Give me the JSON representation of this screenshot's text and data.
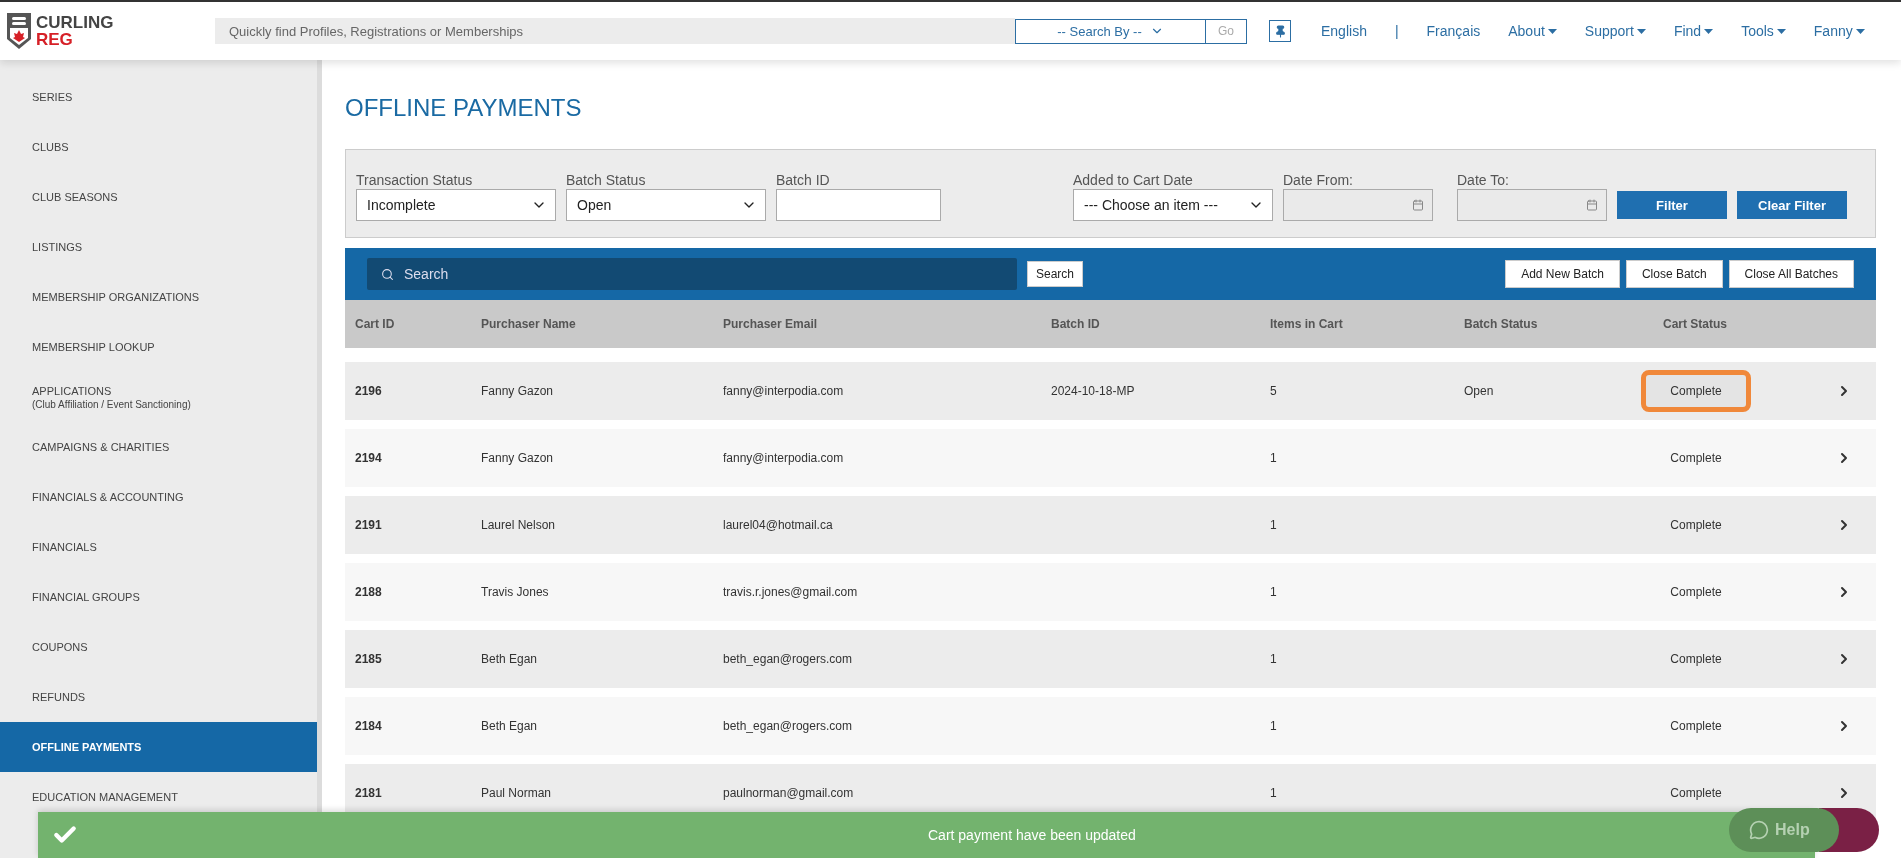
{
  "header": {
    "logo_line1": "CURLING",
    "logo_line2": "REG",
    "search_placeholder": "Quickly find Profiles, Registrations or Memberships",
    "search_by": "-- Search By --",
    "go": "Go",
    "nav": [
      {
        "label": "English",
        "kind": "link"
      },
      {
        "label": "|",
        "kind": "separator"
      },
      {
        "label": "Français",
        "kind": "link"
      },
      {
        "label": "About",
        "kind": "menu"
      },
      {
        "label": "Support",
        "kind": "menu"
      },
      {
        "label": "Find",
        "kind": "menu"
      },
      {
        "label": "Tools",
        "kind": "menu"
      },
      {
        "label": "Fanny",
        "kind": "menu"
      }
    ]
  },
  "sidebar": {
    "items": [
      {
        "label": "SERIES",
        "selected": false
      },
      {
        "label": "CLUBS",
        "selected": false
      },
      {
        "label": "CLUB SEASONS",
        "selected": false
      },
      {
        "label": "LISTINGS",
        "selected": false
      },
      {
        "label": "MEMBERSHIP ORGANIZATIONS",
        "selected": false
      },
      {
        "label": "MEMBERSHIP LOOKUP",
        "selected": false
      },
      {
        "label": "APPLICATIONS",
        "sub": "(Club Affiliation / Event Sanctioning)",
        "selected": false
      },
      {
        "label": "CAMPAIGNS & CHARITIES",
        "selected": false
      },
      {
        "label": "FINANCIALS & ACCOUNTING",
        "selected": false
      },
      {
        "label": "FINANCIALS",
        "selected": false
      },
      {
        "label": "FINANCIAL GROUPS",
        "selected": false
      },
      {
        "label": "COUPONS",
        "selected": false
      },
      {
        "label": "REFUNDS",
        "selected": false
      },
      {
        "label": "OFFLINE PAYMENTS",
        "selected": true
      },
      {
        "label": "EDUCATION MANAGEMENT",
        "selected": false
      }
    ]
  },
  "page_title": "OFFLINE PAYMENTS",
  "filters": [
    {
      "label": "Transaction Status",
      "kind": "select",
      "value": "Incomplete"
    },
    {
      "label": "Batch Status",
      "kind": "select",
      "value": "Open"
    },
    {
      "label": "Batch ID",
      "kind": "text"
    },
    {
      "label": "Added to Cart Date",
      "kind": "select",
      "value": "--- Choose an item ---"
    },
    {
      "label": "Date From:",
      "kind": "date"
    },
    {
      "label": "Date To:",
      "kind": "date"
    }
  ],
  "filter_buttons": [
    "Filter",
    "Clear Filter"
  ],
  "toolbar": {
    "search_placeholder": "Search",
    "search_button": "Search",
    "buttons": [
      "Add New Batch",
      "Close Batch",
      "Close All Batches"
    ]
  },
  "table": {
    "columns": [
      "Cart ID",
      "Purchaser Name",
      "Purchaser Email",
      "Batch ID",
      "Items in Cart",
      "Batch Status",
      "Cart Status"
    ],
    "rows": [
      {
        "cells": [
          "2196",
          "Fanny Gazon",
          "fanny@interpodia.com",
          "2024-10-18-MP",
          "5",
          "Open",
          "Complete"
        ],
        "highlighted": true
      },
      {
        "cells": [
          "2194",
          "Fanny Gazon",
          "fanny@interpodia.com",
          "",
          "1",
          "",
          "Complete"
        ],
        "highlighted": false
      },
      {
        "cells": [
          "2191",
          "Laurel Nelson",
          "laurel04@hotmail.ca",
          "",
          "1",
          "",
          "Complete"
        ],
        "highlighted": false
      },
      {
        "cells": [
          "2188",
          "Travis Jones",
          "travis.r.jones@gmail.com",
          "",
          "1",
          "",
          "Complete"
        ],
        "highlighted": false
      },
      {
        "cells": [
          "2185",
          "Beth Egan",
          "beth_egan@rogers.com",
          "",
          "1",
          "",
          "Complete"
        ],
        "highlighted": false
      },
      {
        "cells": [
          "2184",
          "Beth Egan",
          "beth_egan@rogers.com",
          "",
          "1",
          "",
          "Complete"
        ],
        "highlighted": false
      },
      {
        "cells": [
          "2181",
          "Paul Norman",
          "paulnorman@gmail.com",
          "",
          "1",
          "",
          "Complete"
        ],
        "highlighted": false
      }
    ]
  },
  "toast": {
    "message": "Cart payment have been updated"
  },
  "help": {
    "label": "Help"
  }
}
